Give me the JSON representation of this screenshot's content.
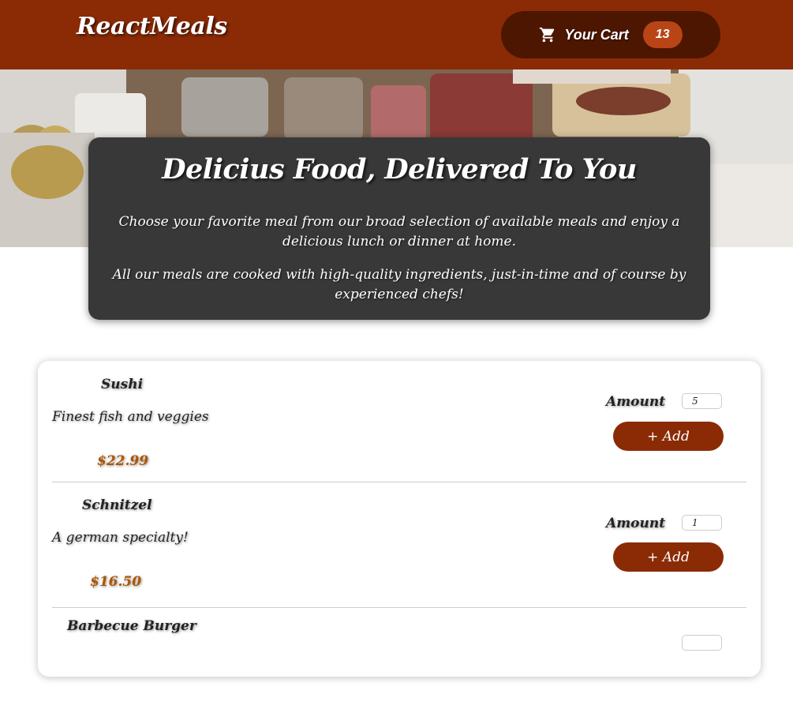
{
  "header": {
    "logo": "ReactMeals",
    "cart": {
      "label": "Your Cart",
      "count": "13",
      "icon": "shopping-cart-icon"
    },
    "colors": {
      "bar": "#8a2b06",
      "cart_button": "#4d1601",
      "badge": "#b94517"
    }
  },
  "hero": {
    "image": "food-buffet-photo"
  },
  "summary": {
    "title": "Delicius Food, Delivered To You",
    "paragraph1": "Choose your favorite meal from our broad selection of available meals and enjoy a delicious lunch or dinner at home.",
    "paragraph2": "All our meals are cooked with high-quality ingredients, just-in-time and of course by experienced chefs!"
  },
  "meals": [
    {
      "name": "Sushi",
      "description": "Finest fish and veggies",
      "price": "$22.99",
      "amount_label": "Amount",
      "amount_value": "5",
      "add_label": "+ Add"
    },
    {
      "name": "Schnitzel",
      "description": "A german specialty!",
      "price": "$16.50",
      "amount_label": "Amount",
      "amount_value": "1",
      "add_label": "+ Add"
    },
    {
      "name": "Barbecue Burger",
      "description": "",
      "price": "",
      "amount_label": "",
      "amount_value": "",
      "add_label": ""
    }
  ]
}
